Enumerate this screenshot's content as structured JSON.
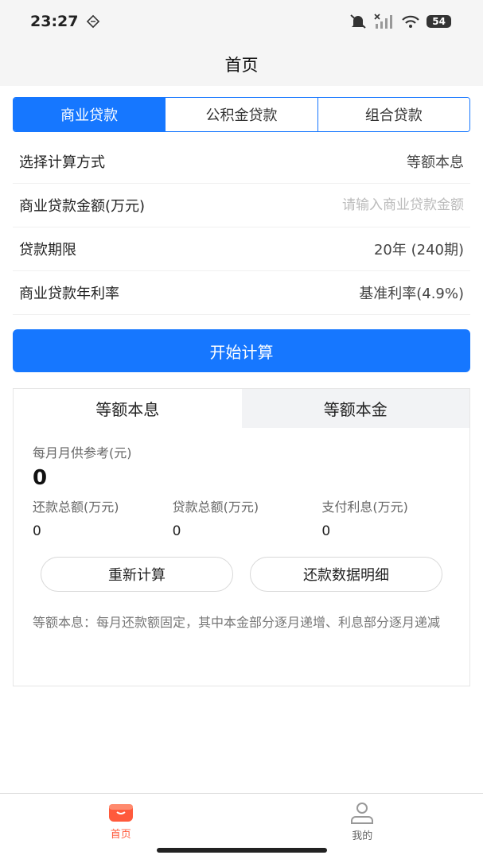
{
  "status_bar": {
    "time": "23:27",
    "battery": "54"
  },
  "nav": {
    "title": "首页"
  },
  "loan_tabs": [
    {
      "label": "商业贷款",
      "active": true
    },
    {
      "label": "公积金贷款",
      "active": false
    },
    {
      "label": "组合贷款",
      "active": false
    }
  ],
  "form": {
    "method": {
      "label": "选择计算方式",
      "value": "等额本息"
    },
    "amount": {
      "label": "商业贷款金额(万元)",
      "placeholder": "请输入商业贷款金额",
      "value": ""
    },
    "term": {
      "label": "贷款期限",
      "value": "20年 (240期)"
    },
    "rate": {
      "label": "商业贷款年利率",
      "value": "基准利率(4.9%)"
    }
  },
  "calculate_button": "开始计算",
  "result": {
    "tabs": [
      {
        "label": "等额本息",
        "active": true
      },
      {
        "label": "等额本金",
        "active": false
      }
    ],
    "monthly_label": "每月月供参考(元)",
    "monthly_value": "0",
    "stats": [
      {
        "label": "还款总额(万元)",
        "value": "0"
      },
      {
        "label": "贷款总额(万元)",
        "value": "0"
      },
      {
        "label": "支付利息(万元)",
        "value": "0"
      }
    ],
    "recalc_button": "重新计算",
    "detail_button": "还款数据明细",
    "note": "等额本息：每月还款额固定，其中本金部分逐月递增、利息部分逐月递减"
  },
  "bottom_nav": [
    {
      "label": "首页",
      "icon": "home-icon",
      "active": true
    },
    {
      "label": "我的",
      "icon": "user-icon",
      "active": false
    }
  ],
  "colors": {
    "primary": "#1677ff",
    "active_nav": "#ff5a3c"
  }
}
